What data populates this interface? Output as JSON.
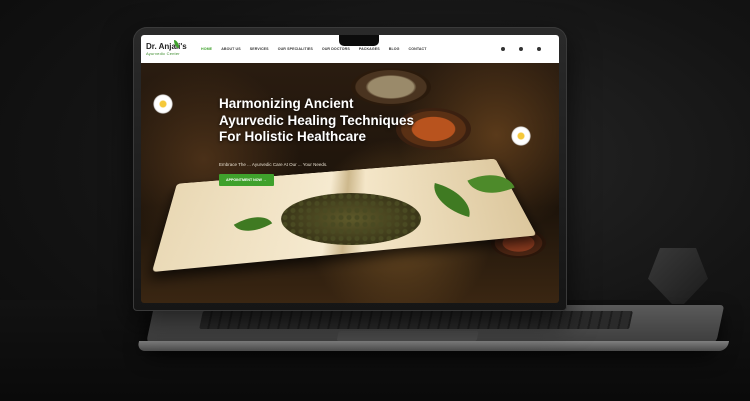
{
  "logo": {
    "name": "Dr. Anjali's",
    "tagline": "Ayurvedic Center"
  },
  "nav": {
    "items": [
      "HOME",
      "ABOUT US",
      "SERVICES",
      "OUR SPECIALITIES",
      "OUR DOCTORS",
      "PACKAGES",
      "BLOG",
      "CONTACT"
    ]
  },
  "hero": {
    "title": "Harmonizing Ancient Ayurvedic Healing Techniques For Holistic Healthcare",
    "subtitle": "Embrace The ... Ayurvedic Care At Our ... Your Needs.",
    "cta": "APPOINTMENT NOW →"
  },
  "colors": {
    "accent": "#3fa12c",
    "header_bg": "#ffffff",
    "device": "#3c3c3c"
  }
}
